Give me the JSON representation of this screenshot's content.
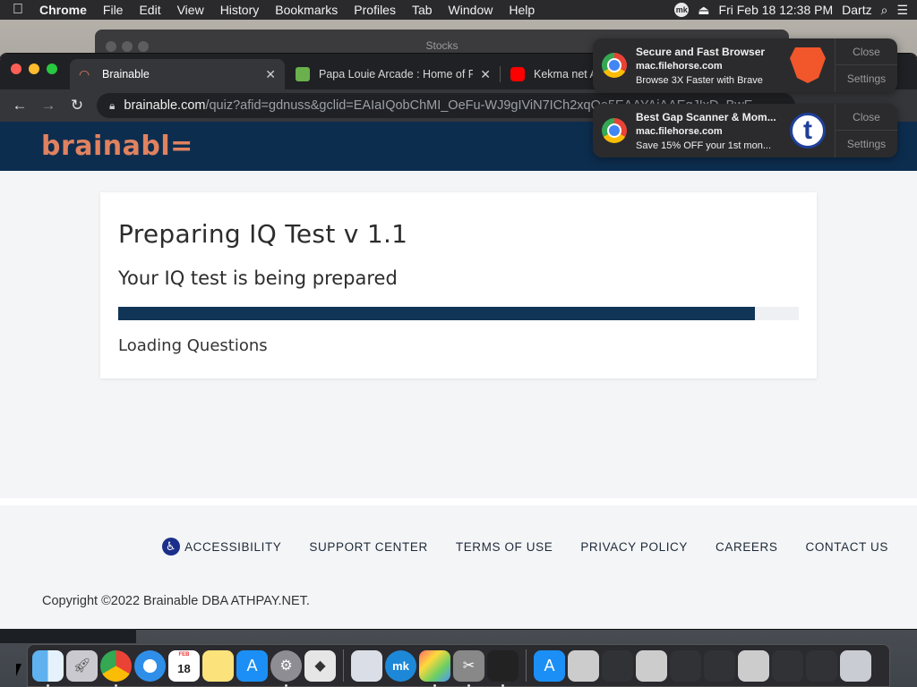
{
  "menubar": {
    "app": "Chrome",
    "items": [
      "File",
      "Edit",
      "View",
      "History",
      "Bookmarks",
      "Profiles",
      "Tab",
      "Window",
      "Help"
    ],
    "status_badge": "mk",
    "datetime": "Fri Feb 18  12:38 PM",
    "user": "Dartz"
  },
  "background_window": {
    "title": "Stocks"
  },
  "browser": {
    "tabs": [
      {
        "label": "Brainable",
        "active": true
      },
      {
        "label": "Papa Louie Arcade : Home of F",
        "active": false
      },
      {
        "label": "Kekma net A",
        "active": false
      }
    ],
    "url_host": "brainable.com",
    "url_path": "/quiz?afid=gdnuss&gclid=EAIaIQobChMI_OeFu-WJ9gIViN7ICh2xqQe5EAAYAiAAEgJIxD_BwE"
  },
  "site": {
    "logo": "brainabl=",
    "card": {
      "title": "Preparing IQ Test v 1.1",
      "subtitle": "Your IQ test is being prepared",
      "progress_fraction": 0.935,
      "status": "Loading Questions"
    },
    "footer": {
      "links": [
        "ACCESSIBILITY",
        "SUPPORT CENTER",
        "TERMS OF USE",
        "PRIVACY POLICY",
        "CAREERS",
        "CONTACT US"
      ],
      "copyright": "Copyright ©2022 Brainable DBA ATHPAY.NET."
    }
  },
  "notifications": [
    {
      "title": "Secure and Fast Browser",
      "source": "mac.filehorse.com",
      "body": "Browse 3X Faster with Brave",
      "close_label": "Close",
      "settings_label": "Settings"
    },
    {
      "title": "Best Gap Scanner & Mom...",
      "source": "mac.filehorse.com",
      "body": "Save 15% OFF your 1st mon...",
      "close_label": "Close",
      "settings_label": "Settings"
    }
  ],
  "dock": {
    "calendar_day": "18",
    "mk_label": "mk"
  },
  "colors": {
    "header_bg": "#0d2d4f",
    "logo": "#e0825f",
    "progress_fill": "#103556"
  }
}
